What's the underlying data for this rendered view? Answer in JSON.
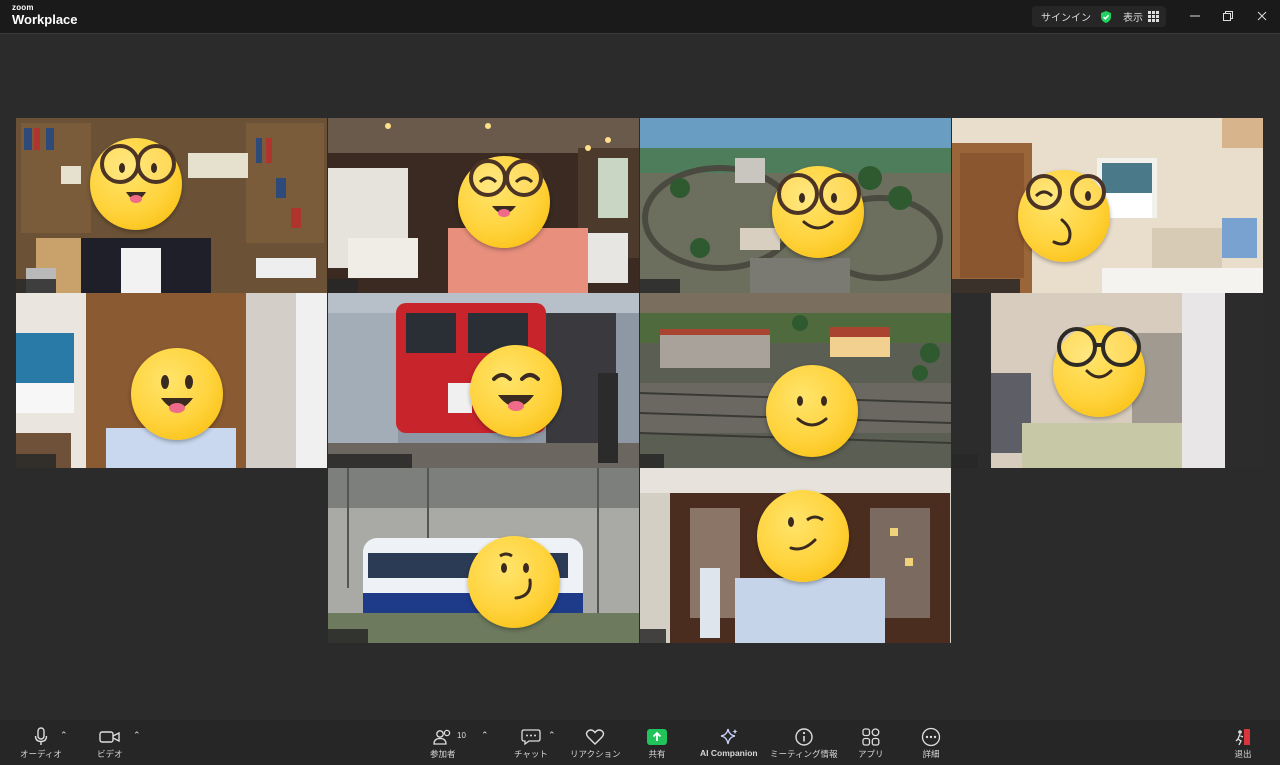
{
  "app": {
    "logo_small": "zoom",
    "logo_big": "Workplace"
  },
  "titlebar": {
    "signin_label": "サインイン",
    "view_label": "表示",
    "icons": [
      "shield-check-icon",
      "grid-icon",
      "minimize-icon",
      "restore-icon",
      "close-icon"
    ]
  },
  "participants_grid": {
    "tile_count": 10,
    "active_speaker_tile": 1,
    "active_color": "#23d160"
  },
  "toolbar": {
    "audio_label": "オーディオ",
    "video_label": "ビデオ",
    "participants_label": "参加者",
    "participants_count": "10",
    "chat_label": "チャット",
    "reactions_label": "リアクション",
    "share_label": "共有",
    "ai_label": "AI Companion",
    "meeting_info_label": "ミーティング情報",
    "apps_label": "アプリ",
    "more_label": "詳細",
    "leave_label": "退出",
    "share_color": "#21c45b"
  }
}
